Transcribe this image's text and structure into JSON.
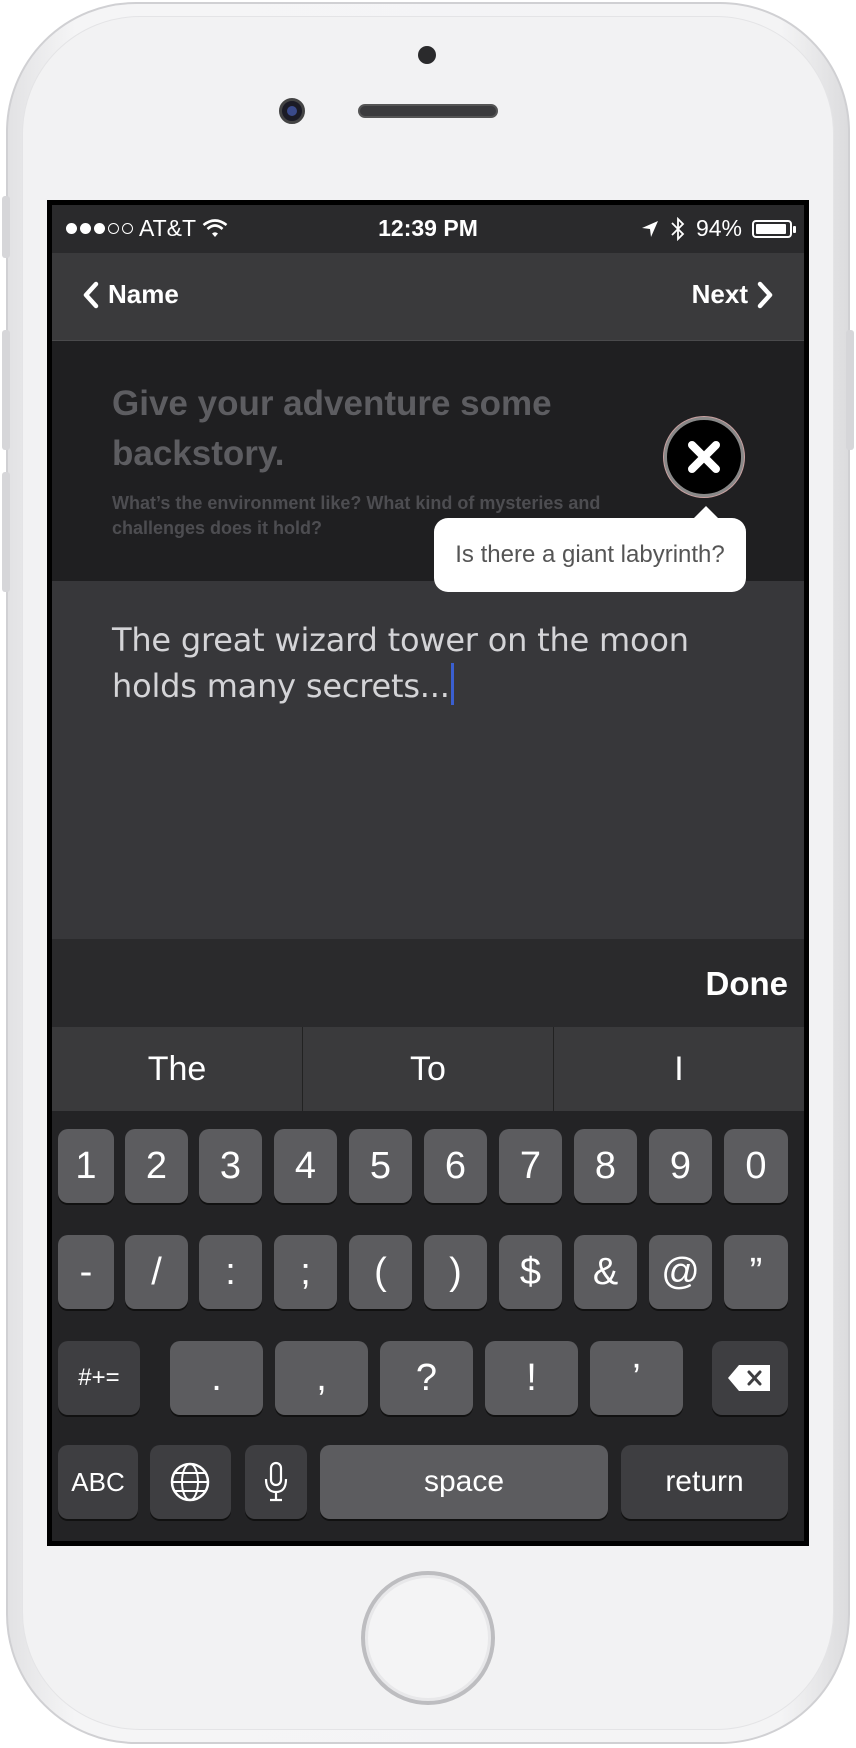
{
  "status_bar": {
    "carrier": "AT&T",
    "time": "12:39 PM",
    "battery": "94%",
    "battery_level": 0.94,
    "signal_dots_filled": 3,
    "signal_dots_total": 5
  },
  "nav": {
    "back_label": "Name",
    "next_label": "Next"
  },
  "prompt": {
    "title": "Give your adventure some backstory.",
    "subtitle": "What’s the environment like? What kind of mysteries and challenges does it hold?"
  },
  "tooltip": {
    "text": "Is there a giant labyrinth?"
  },
  "editor": {
    "text": "The great wizard tower on the moon holds many secrets..."
  },
  "accessory": {
    "done_label": "Done"
  },
  "suggestions": [
    "The",
    "To",
    "I"
  ],
  "keyboard": {
    "row1": [
      "1",
      "2",
      "3",
      "4",
      "5",
      "6",
      "7",
      "8",
      "9",
      "0"
    ],
    "row2": [
      "-",
      "/",
      ":",
      ";",
      "(",
      ")",
      "$",
      "&",
      "@",
      "”"
    ],
    "row3_mode": "#+=",
    "row3": [
      ".",
      ",",
      "?",
      "!",
      "’"
    ],
    "row4_abc": "ABC",
    "space": "space",
    "return": "return"
  },
  "colors": {
    "caret": "#3a5fd0",
    "background": "#2b2b2d"
  }
}
